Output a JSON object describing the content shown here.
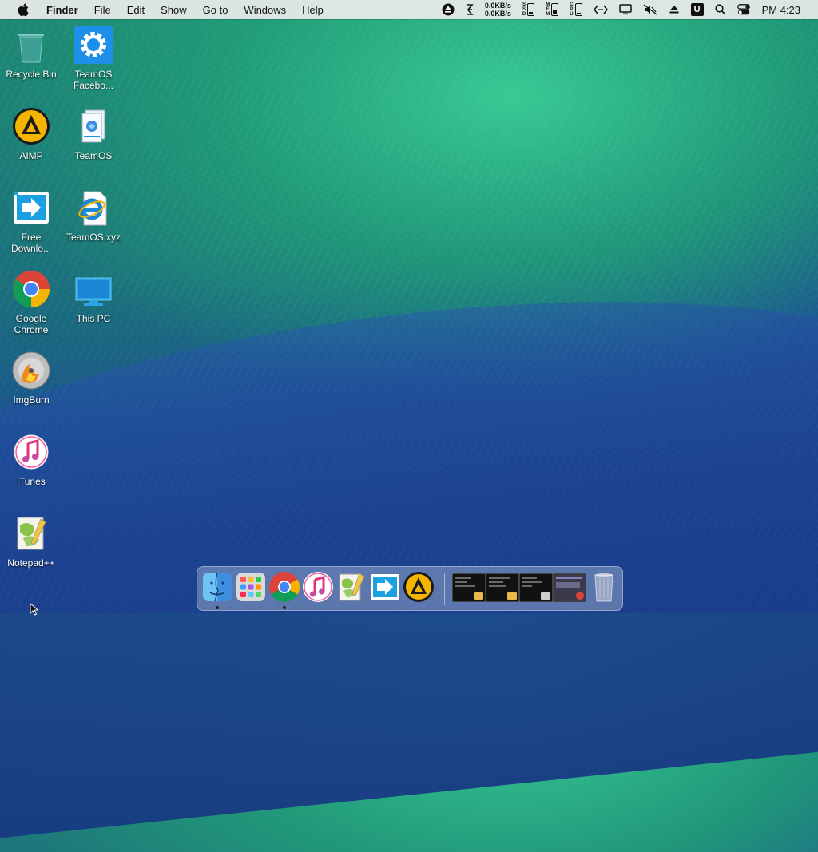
{
  "menubar": {
    "app_name": "Finder",
    "menus": [
      "File",
      "Edit",
      "Show",
      "Go to",
      "Windows",
      "Help"
    ],
    "net_up": "0.0KB/s",
    "net_down": "0.0KB/s",
    "clock": "PM 4:23",
    "status_icons": [
      "eject-icon",
      "sync-icon",
      "netspeed",
      "drive-c-icon",
      "memory-icon",
      "drive-cpu-icon",
      "code-icon",
      "display-icon",
      "mute-icon",
      "eject-icon",
      "u-icon",
      "search-icon",
      "control-center-icon"
    ],
    "u_label": "U"
  },
  "desktop": {
    "icons": [
      {
        "id": "recycle-bin",
        "label": "Recycle Bin"
      },
      {
        "id": "teamos-facebook",
        "label": "TeamOS Facebo..."
      },
      {
        "id": "aimp",
        "label": "AIMP"
      },
      {
        "id": "teamos",
        "label": "TeamOS"
      },
      {
        "id": "free-download",
        "label": "Free Downlo..."
      },
      {
        "id": "teamos-xyz",
        "label": "TeamOS.xyz"
      },
      {
        "id": "google-chrome",
        "label": "Google Chrome"
      },
      {
        "id": "this-pc",
        "label": "This PC"
      },
      {
        "id": "imgburn",
        "label": "ImgBurn"
      },
      {
        "id": "itunes",
        "label": "iTunes"
      },
      {
        "id": "notepadpp",
        "label": "Notepad++"
      }
    ]
  },
  "dock": {
    "apps": [
      "finder",
      "launchpad",
      "chrome",
      "itunes",
      "notepad-plus-plus",
      "free-download-manager",
      "aimp"
    ],
    "running": [
      "finder",
      "chrome"
    ],
    "windows": [
      "window-thumbnail-1",
      "window-thumbnail-2",
      "window-thumbnail-3",
      "window-thumbnail-4"
    ],
    "trash": "trash"
  },
  "colors": {
    "menubar_bg": "#ececec",
    "aimp_yellow": "#f5b400",
    "fdm_blue": "#1ba1e2",
    "win_blue": "#1e8fe8"
  }
}
